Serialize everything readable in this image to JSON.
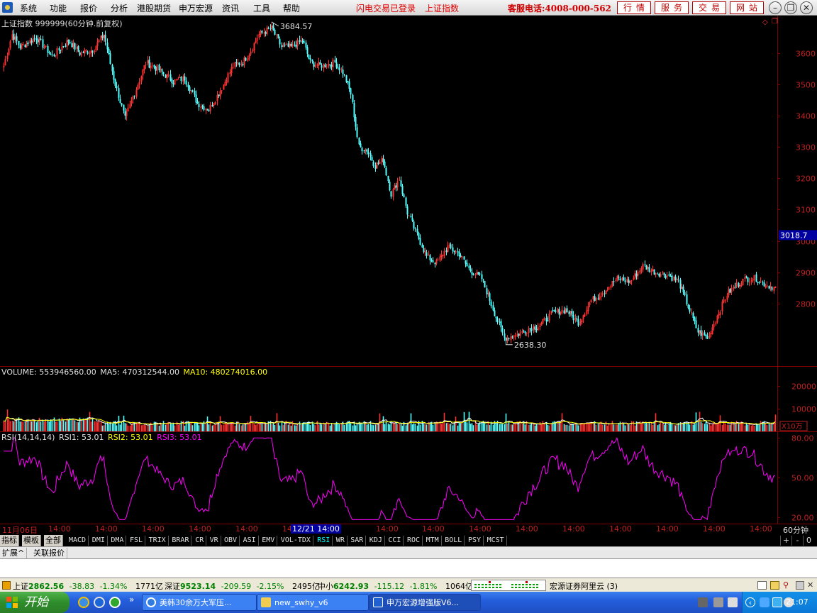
{
  "menu": {
    "items": [
      "系统",
      "功能",
      "报价",
      "分析",
      "港股期货",
      "申万宏源",
      "资讯",
      "工具",
      "帮助"
    ],
    "status_flash": "闪电交易已登录",
    "status_index": "上证指数",
    "hotline": "客服电话:4008-000-562",
    "buttons": [
      "行情",
      "服务",
      "交易",
      "网站"
    ]
  },
  "price_pane": {
    "title": "上证指数 999999(60分钟.前复权)",
    "high_label": "3684.57",
    "low_label": "2638.30",
    "current_label": "3018.7",
    "y_ticks": [
      "3600",
      "3500",
      "3400",
      "3300",
      "3200",
      "3100",
      "3000",
      "2900",
      "2800"
    ]
  },
  "volume_pane": {
    "title": "VOLUME: 553946560.00",
    "ma5": "MA5: 470312544.00",
    "ma10": "MA10: 480274016.00",
    "y_ticks": [
      "20000",
      "10000"
    ],
    "unit": "X10万"
  },
  "rsi_pane": {
    "title": "RSI(14,14,14)",
    "rsi1": "RSI1: 53.01",
    "rsi2": "RSI2: 53.01",
    "rsi3": "RSI3: 53.01",
    "y_ticks": [
      "80.00",
      "50.00",
      "20.00"
    ]
  },
  "time_axis": {
    "ticks": [
      "11月06日",
      "14:00",
      "14:00",
      "14:00",
      "14:00",
      "14:00",
      "14:00",
      "14",
      "12/21 14:00",
      "14:00",
      "14:00",
      "14:00",
      "14:00",
      "14:00",
      "14:00",
      "14:00",
      "14:00",
      "14:00",
      "14:00",
      "14:00",
      "14:00"
    ],
    "period": "60分钟"
  },
  "indicator_tabs": {
    "zh": [
      "指标",
      "模板",
      "全部"
    ],
    "items": [
      "MACD",
      "DMI",
      "DMA",
      "FSL",
      "TRIX",
      "BRAR",
      "CR",
      "VR",
      "OBV",
      "ASI",
      "EMV",
      "VOL-TDX",
      "RSI",
      "WR",
      "SAR",
      "KDJ",
      "CCI",
      "ROC",
      "MTM",
      "BOLL",
      "PSY",
      "MCST"
    ],
    "active": "RSI",
    "controls": [
      "+",
      "-",
      "0"
    ]
  },
  "sub_tabs": [
    "扩展^",
    "关联报价"
  ],
  "status_bar": {
    "sh": {
      "name": "上证",
      "value": "2862.56",
      "change": "-38.83",
      "pct": "-1.34%",
      "amount": "1771亿"
    },
    "sz": {
      "name": "深证",
      "value": "9523.14",
      "change": "-209.59",
      "pct": "-2.15%",
      "amount": "2495亿"
    },
    "sme": {
      "name": "中小",
      "value": "6242.93",
      "change": "-115.12",
      "pct": "-1.81%",
      "amount": "1064亿"
    },
    "server": "宏源证券阿里云 (3)"
  },
  "taskbar": {
    "start": "开始",
    "tasks": [
      "美韩30余万大军压...",
      "new_swhy_v6",
      "申万宏源增强版V6..."
    ],
    "clock": "21:07"
  },
  "colors": {
    "up": "#ff3232",
    "down": "#54ffff",
    "grid": "#800000",
    "ma5": "#ffffff",
    "ma10": "#ffff00",
    "rsi": "#ff00ff"
  },
  "chart_data": {
    "type": "candlestick",
    "price_range": [
      2600,
      3720
    ],
    "rsi_range": [
      15,
      85
    ],
    "volume_range": [
      0,
      27000
    ],
    "candles": [],
    "rsi": []
  }
}
